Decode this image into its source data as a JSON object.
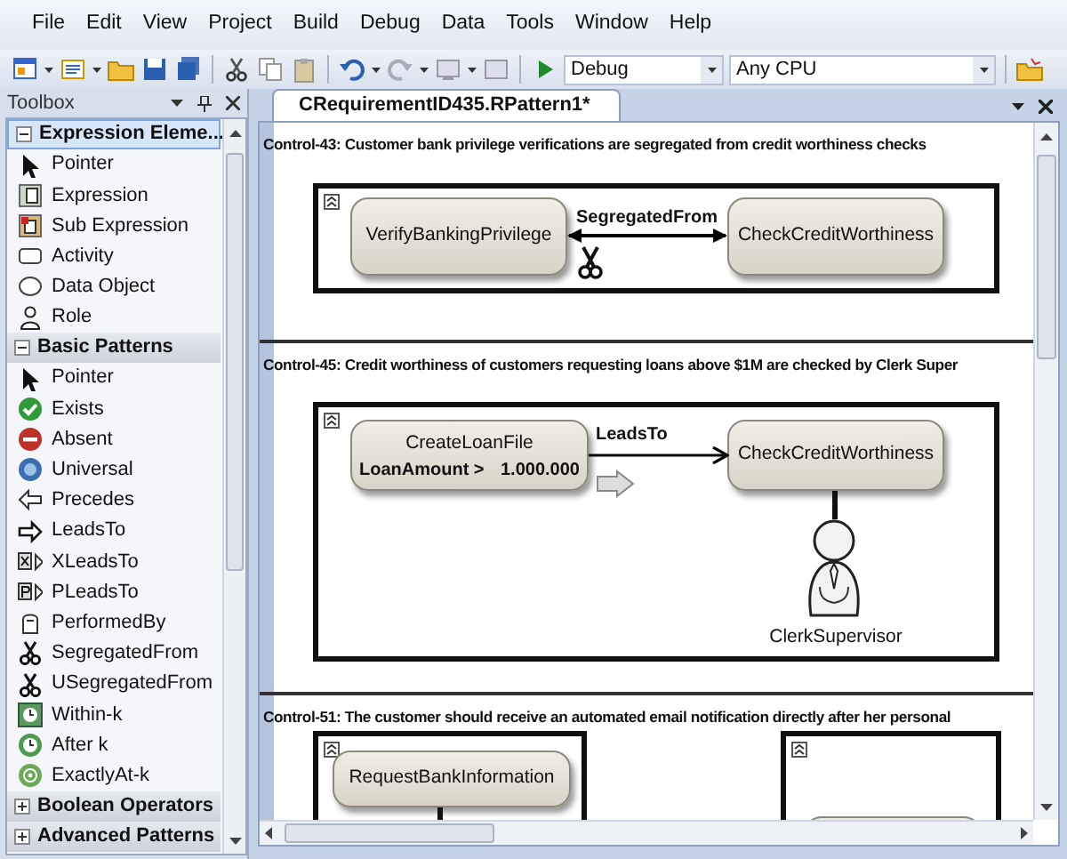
{
  "menu": [
    "File",
    "Edit",
    "View",
    "Project",
    "Build",
    "Debug",
    "Data",
    "Tools",
    "Window",
    "Help"
  ],
  "toolbar": {
    "configuration": "Debug",
    "platform": "Any CPU"
  },
  "toolbox": {
    "title": "Toolbox",
    "groups": [
      {
        "label": "Expression Eleme...",
        "selected": true,
        "expanded": true,
        "items": [
          "Pointer",
          "Expression",
          "Sub Expression",
          "Activity",
          "Data Object",
          "Role"
        ]
      },
      {
        "label": "Basic Patterns",
        "selected": false,
        "expanded": true,
        "items": [
          "Pointer",
          "Exists",
          "Absent",
          "Universal",
          "Precedes",
          "LeadsTo",
          "XLeadsTo",
          "PLeadsTo",
          "PerformedBy",
          "SegregatedFrom",
          "USegregatedFrom",
          "Within-k",
          "After k",
          "ExactlyAt-k"
        ]
      },
      {
        "label": "Boolean Operators",
        "selected": false,
        "expanded": false
      },
      {
        "label": "Advanced Patterns",
        "selected": false,
        "expanded": false
      }
    ]
  },
  "document": {
    "tab": {
      "label": "CRequirementID435.RPattern1*",
      "selected": true
    },
    "controls": [
      {
        "heading": "Control-43: Customer bank privilege verifications are segregated from credit worthiness checks",
        "diagram": {
          "kind": "segregation",
          "relation": "SegregatedFrom",
          "nodes": [
            {
              "label": "VerifyBankingPrivilege"
            },
            {
              "label": "CheckCreditWorthiness"
            }
          ]
        }
      },
      {
        "heading": "Control-45: Credit worthiness of customers requesting loans above $1M are checked by Clerk Super",
        "diagram": {
          "kind": "leads_to",
          "relation": "LeadsTo",
          "role": "ClerkSupervisor",
          "nodes": [
            {
              "label": "CreateLoanFile",
              "condition": [
                "LoanAmount >",
                "1.000.000"
              ]
            },
            {
              "label": "CheckCreditWorthiness"
            }
          ]
        }
      },
      {
        "heading": "Control-51: The customer should receive an automated email notification directly after her personal",
        "diagram": {
          "kind": "split",
          "nodes": [
            {
              "label": "RequestBankInformation"
            }
          ]
        }
      }
    ]
  }
}
